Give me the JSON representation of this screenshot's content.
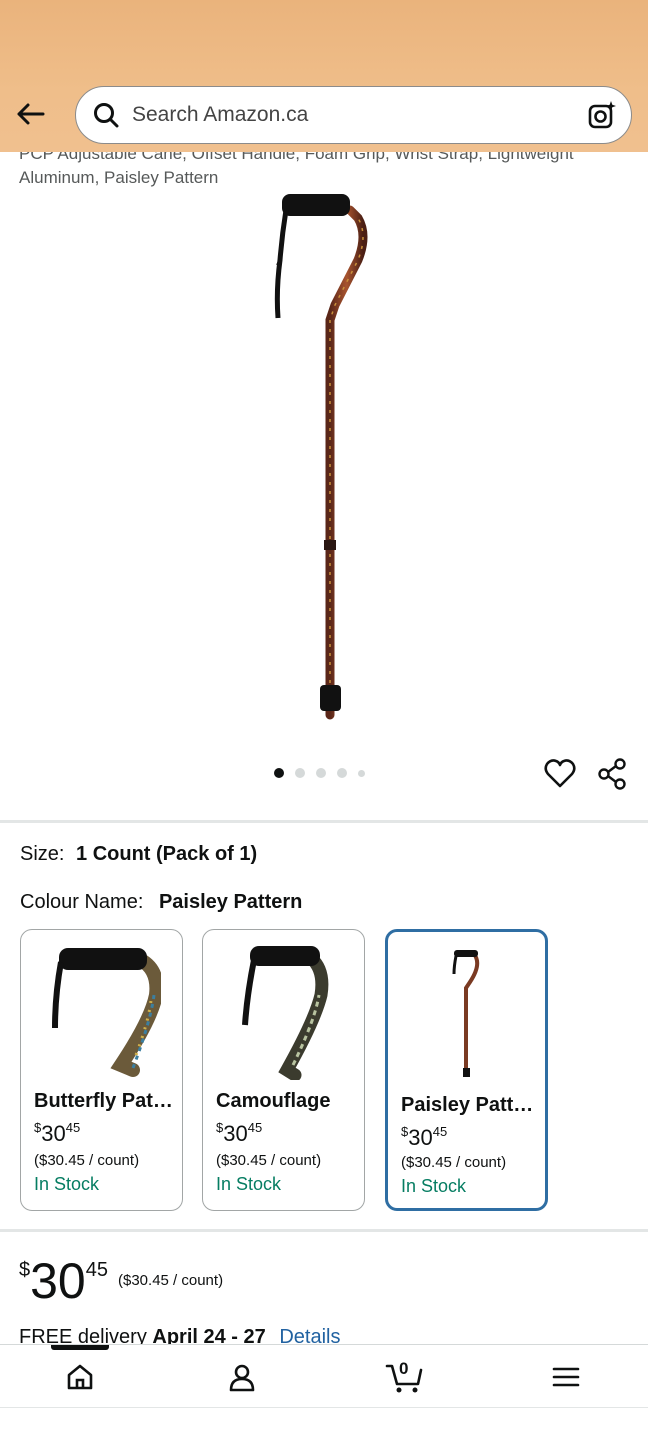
{
  "header": {
    "search_placeholder": "Search Amazon.ca",
    "back_icon": "arrow-left-icon",
    "lens_icon": "camera-lens-icon",
    "accent_color": "#eab37c"
  },
  "product": {
    "title": "PCP Adjustable Cane, Offset Handle, Foam Grip, Wrist Strap, Lightweight Aluminum, Paisley Pattern",
    "image_dots_count": 5,
    "active_dot": 1
  },
  "options": {
    "size_label": "Size:",
    "size_value": "1 Count (Pack of 1)",
    "colour_label": "Colour Name:",
    "colour_value": "Paisley Pattern",
    "swatches": [
      {
        "name": "Butterfly Pattern",
        "price_currency": "$",
        "price_whole": "30",
        "price_fraction": "45",
        "unit_price": "($30.45 / count)",
        "stock": "In Stock",
        "selected": false
      },
      {
        "name": "Camouflage",
        "price_currency": "$",
        "price_whole": "30",
        "price_fraction": "45",
        "unit_price": "($30.45 / count)",
        "stock": "In Stock",
        "selected": false
      },
      {
        "name": "Paisley Pattern",
        "price_currency": "$",
        "price_whole": "30",
        "price_fraction": "45",
        "unit_price": "($30.45 / count)",
        "stock": "In Stock",
        "selected": true
      }
    ]
  },
  "buybox": {
    "price_currency": "$",
    "price_whole": "30",
    "price_fraction": "45",
    "unit_price": "($30.45 / count)",
    "delivery_prefix": "FREE delivery",
    "delivery_dates": "April 24 - 27",
    "details_link": "Details"
  },
  "bottom_nav": {
    "cart_count": "0",
    "items": [
      "home-icon",
      "account-icon",
      "cart-icon",
      "menu-icon"
    ]
  },
  "colors": {
    "stock_green": "#067d62",
    "link_blue": "#2162a1",
    "selected_border": "#2f6ea3"
  }
}
